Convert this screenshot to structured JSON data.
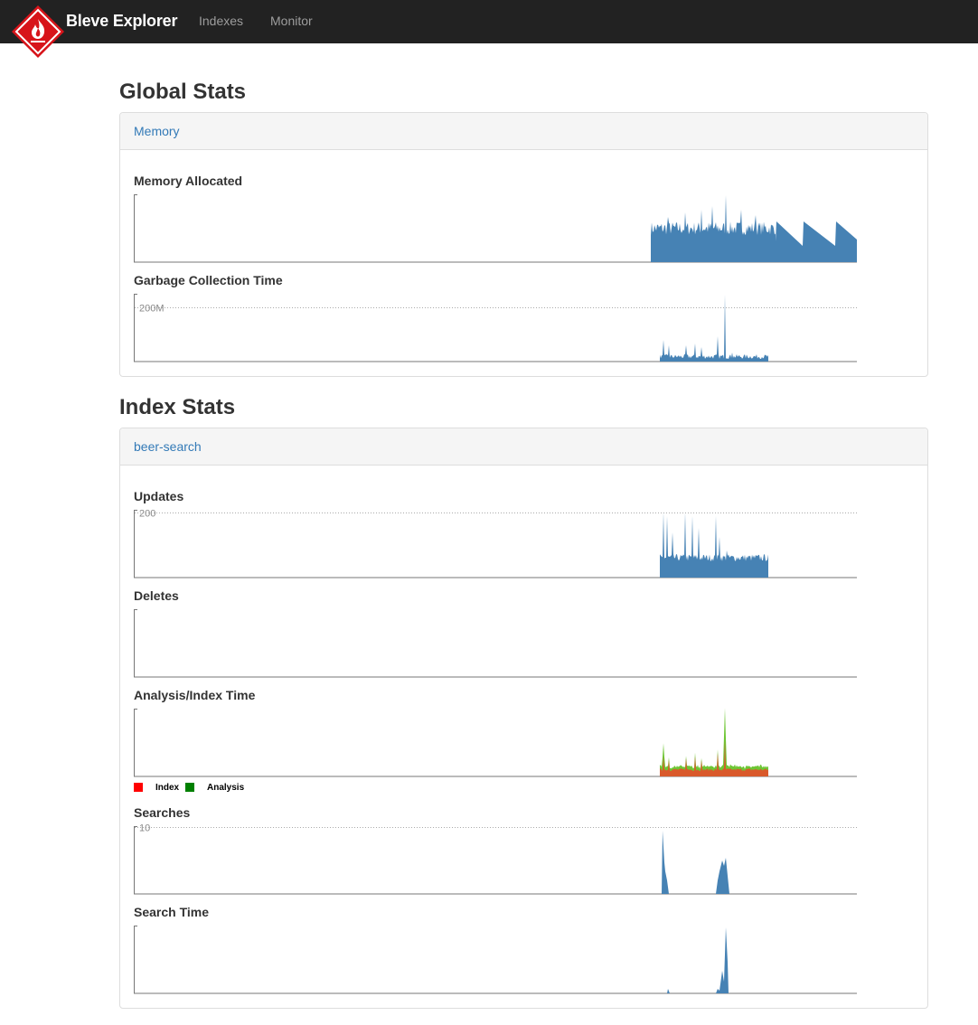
{
  "navbar": {
    "brand": "Bleve Explorer",
    "links": [
      "Indexes",
      "Monitor"
    ]
  },
  "global_stats": {
    "heading": "Global Stats",
    "panel_title": "Memory",
    "charts": {
      "memory_allocated": {
        "title": "Memory Allocated"
      },
      "gc_time": {
        "title": "Garbage Collection Time",
        "y_label": "200M"
      }
    }
  },
  "index_stats": {
    "heading": "Index Stats",
    "panel_title": "beer-search",
    "charts": {
      "updates": {
        "title": "Updates",
        "y_label": "200"
      },
      "deletes": {
        "title": "Deletes"
      },
      "analysis_index_time": {
        "title": "Analysis/Index Time"
      },
      "searches": {
        "title": "Searches",
        "y_label": "10"
      },
      "search_time": {
        "title": "Search Time"
      }
    },
    "legend": [
      {
        "label": "Index",
        "color": "#ff0000"
      },
      {
        "label": "Analysis",
        "color": "#008000"
      }
    ]
  },
  "colors": {
    "area": "#4682b4",
    "index_area": "#d9592b",
    "analysis_area": "#6ec634",
    "navbar": "#222222",
    "link": "#337ab7",
    "logo_red": "#d7141a"
  },
  "chart_data": [
    {
      "type": "area",
      "id": "memory_allocated",
      "title": "Memory Allocated"
    },
    {
      "type": "area",
      "id": "gc_time",
      "title": "Garbage Collection Time",
      "gridline_label": "200M"
    },
    {
      "type": "area",
      "id": "updates",
      "title": "Updates",
      "gridline_label": "200"
    },
    {
      "type": "area",
      "id": "deletes",
      "title": "Deletes"
    },
    {
      "type": "area",
      "id": "analysis_index_time",
      "title": "Analysis/Index Time",
      "series": [
        {
          "name": "Index"
        },
        {
          "name": "Analysis"
        }
      ]
    },
    {
      "type": "area",
      "id": "searches",
      "title": "Searches",
      "gridline_label": "10"
    },
    {
      "type": "area",
      "id": "search_time",
      "title": "Search Time"
    }
  ]
}
